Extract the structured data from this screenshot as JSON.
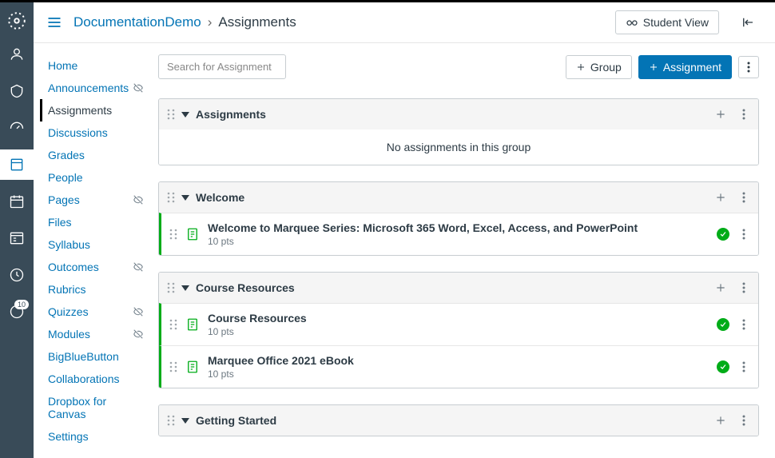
{
  "breadcrumb": {
    "course": "DocumentationDemo",
    "page": "Assignments"
  },
  "header": {
    "student_view": "Student View"
  },
  "toolbar": {
    "search_placeholder": "Search for Assignment",
    "group_btn": "Group",
    "assignment_btn": "Assignment"
  },
  "coursenav": [
    {
      "label": "Home",
      "active": false,
      "hidden": false
    },
    {
      "label": "Announcements",
      "active": false,
      "hidden": true
    },
    {
      "label": "Assignments",
      "active": true,
      "hidden": false
    },
    {
      "label": "Discussions",
      "active": false,
      "hidden": false
    },
    {
      "label": "Grades",
      "active": false,
      "hidden": false
    },
    {
      "label": "People",
      "active": false,
      "hidden": false
    },
    {
      "label": "Pages",
      "active": false,
      "hidden": true
    },
    {
      "label": "Files",
      "active": false,
      "hidden": false
    },
    {
      "label": "Syllabus",
      "active": false,
      "hidden": false
    },
    {
      "label": "Outcomes",
      "active": false,
      "hidden": true
    },
    {
      "label": "Rubrics",
      "active": false,
      "hidden": false
    },
    {
      "label": "Quizzes",
      "active": false,
      "hidden": true
    },
    {
      "label": "Modules",
      "active": false,
      "hidden": true
    },
    {
      "label": "BigBlueButton",
      "active": false,
      "hidden": false
    },
    {
      "label": "Collaborations",
      "active": false,
      "hidden": false
    },
    {
      "label": "Dropbox for Canvas",
      "active": false,
      "hidden": false
    },
    {
      "label": "Settings",
      "active": false,
      "hidden": false
    }
  ],
  "groups": [
    {
      "title": "Assignments",
      "empty": "No assignments in this group",
      "items": []
    },
    {
      "title": "Welcome",
      "items": [
        {
          "title": "Welcome to Marquee Series: Microsoft 365 Word, Excel, Access, and PowerPoint",
          "pts": "10 pts"
        }
      ]
    },
    {
      "title": "Course Resources",
      "items": [
        {
          "title": "Course Resources",
          "pts": "10 pts"
        },
        {
          "title": "Marquee Office 2021 eBook",
          "pts": "10 pts"
        }
      ]
    },
    {
      "title": "Getting Started",
      "items": []
    }
  ],
  "rail": {
    "badge": "10"
  }
}
